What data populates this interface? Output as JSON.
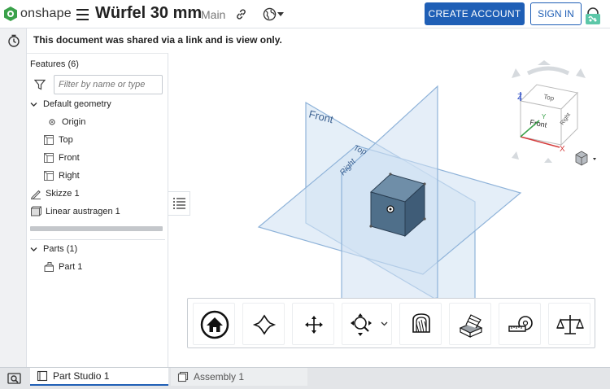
{
  "header": {
    "brand": "onshape",
    "doc_title": "Würfel 30 mm",
    "branch": "Main",
    "create_account": "CREATE ACCOUNT",
    "sign_in": "SIGN IN"
  },
  "notice": "This document was shared via a link and is view only.",
  "features": {
    "title": "Features (6)",
    "filter_placeholder": "Filter by name or type",
    "default_geometry": "Default geometry",
    "origin": "Origin",
    "top": "Top",
    "front": "Front",
    "right": "Right",
    "sketch": "Skizze 1",
    "extrude": "Linear austragen 1"
  },
  "parts": {
    "title": "Parts (1)",
    "part": "Part 1"
  },
  "viewport": {
    "plane_front": "Front",
    "plane_top": "Top",
    "plane_right": "Right",
    "cube_top": "Top",
    "cube_front": "Front",
    "cube_right": "Right",
    "axis_x": "X",
    "axis_y": "Y",
    "axis_z": "Z"
  },
  "tabs": {
    "part_studio": "Part Studio 1",
    "assembly": "Assembly 1"
  },
  "colors": {
    "accent": "#1f5fb6",
    "plane_fill": "#d6e6f5",
    "plane_stroke": "#8fb3d9",
    "part_fill": "#4f6f8a",
    "logo_green": "#3aa14a"
  },
  "icons": [
    "onshape-logo-icon",
    "hamburger-menu-icon",
    "link-icon",
    "globe-icon",
    "help-icon",
    "history-icon",
    "filter-icon",
    "chevron-down-icon",
    "origin-icon",
    "plane-icon",
    "sketch-icon",
    "extrude-icon",
    "part-icon",
    "feature-list-icon",
    "view-cube-icon",
    "home-view-icon",
    "fit-icon",
    "pan-icon",
    "zoom-icon",
    "section-view-icon",
    "render-icon",
    "measure-icon",
    "mass-properties-icon",
    "search-tabs-icon"
  ]
}
